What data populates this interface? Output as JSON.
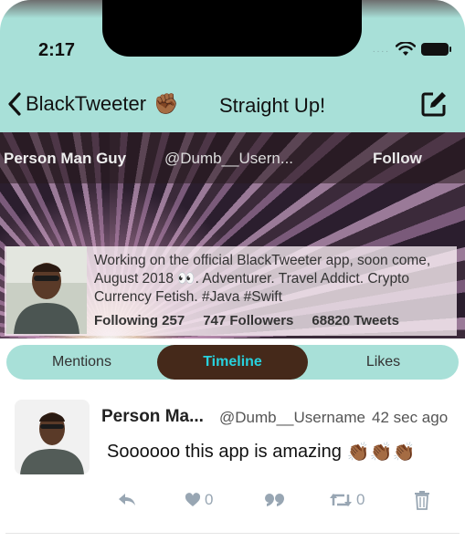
{
  "status_bar": {
    "time": "2:17",
    "signal_dots": "...."
  },
  "nav": {
    "back_label": "BlackTweeter",
    "back_emoji": "✊🏾",
    "title": "Straight Up!"
  },
  "profile": {
    "name": "Person Man Guy",
    "handle": "@Dumb__Usern...",
    "follow_label": "Follow",
    "bio": "Working on the official BlackTweeter app, soon come,  August 2018 👀. Adventurer. Travel Addict. Crypto Currency Fetish. #Java #Swift",
    "following": "Following 257",
    "followers": "747 Followers",
    "tweets": "68820 Tweets"
  },
  "tabs": [
    {
      "label": "Mentions",
      "selected": false
    },
    {
      "label": "Timeline",
      "selected": true
    },
    {
      "label": "Likes",
      "selected": false
    }
  ],
  "tweet": {
    "name": "Person Ma...",
    "handle": "@Dumb__Username",
    "time": "42 sec ago",
    "body": "Soooooo this app is amazing",
    "body_emoji": "👏🏾👏🏾👏🏾",
    "like_count": "0",
    "retweet_count": "0"
  },
  "colors": {
    "accent": "#a8e0d8",
    "selected_tab_bg": "#45291a",
    "selected_tab_text": "#28d1dd",
    "action_icon": "#98a6b3"
  },
  "icons": [
    "back-chevron-icon",
    "compose-icon",
    "wifi-icon",
    "battery-icon",
    "reply-icon",
    "heart-icon",
    "quote-icon",
    "retweet-icon",
    "trash-icon"
  ]
}
